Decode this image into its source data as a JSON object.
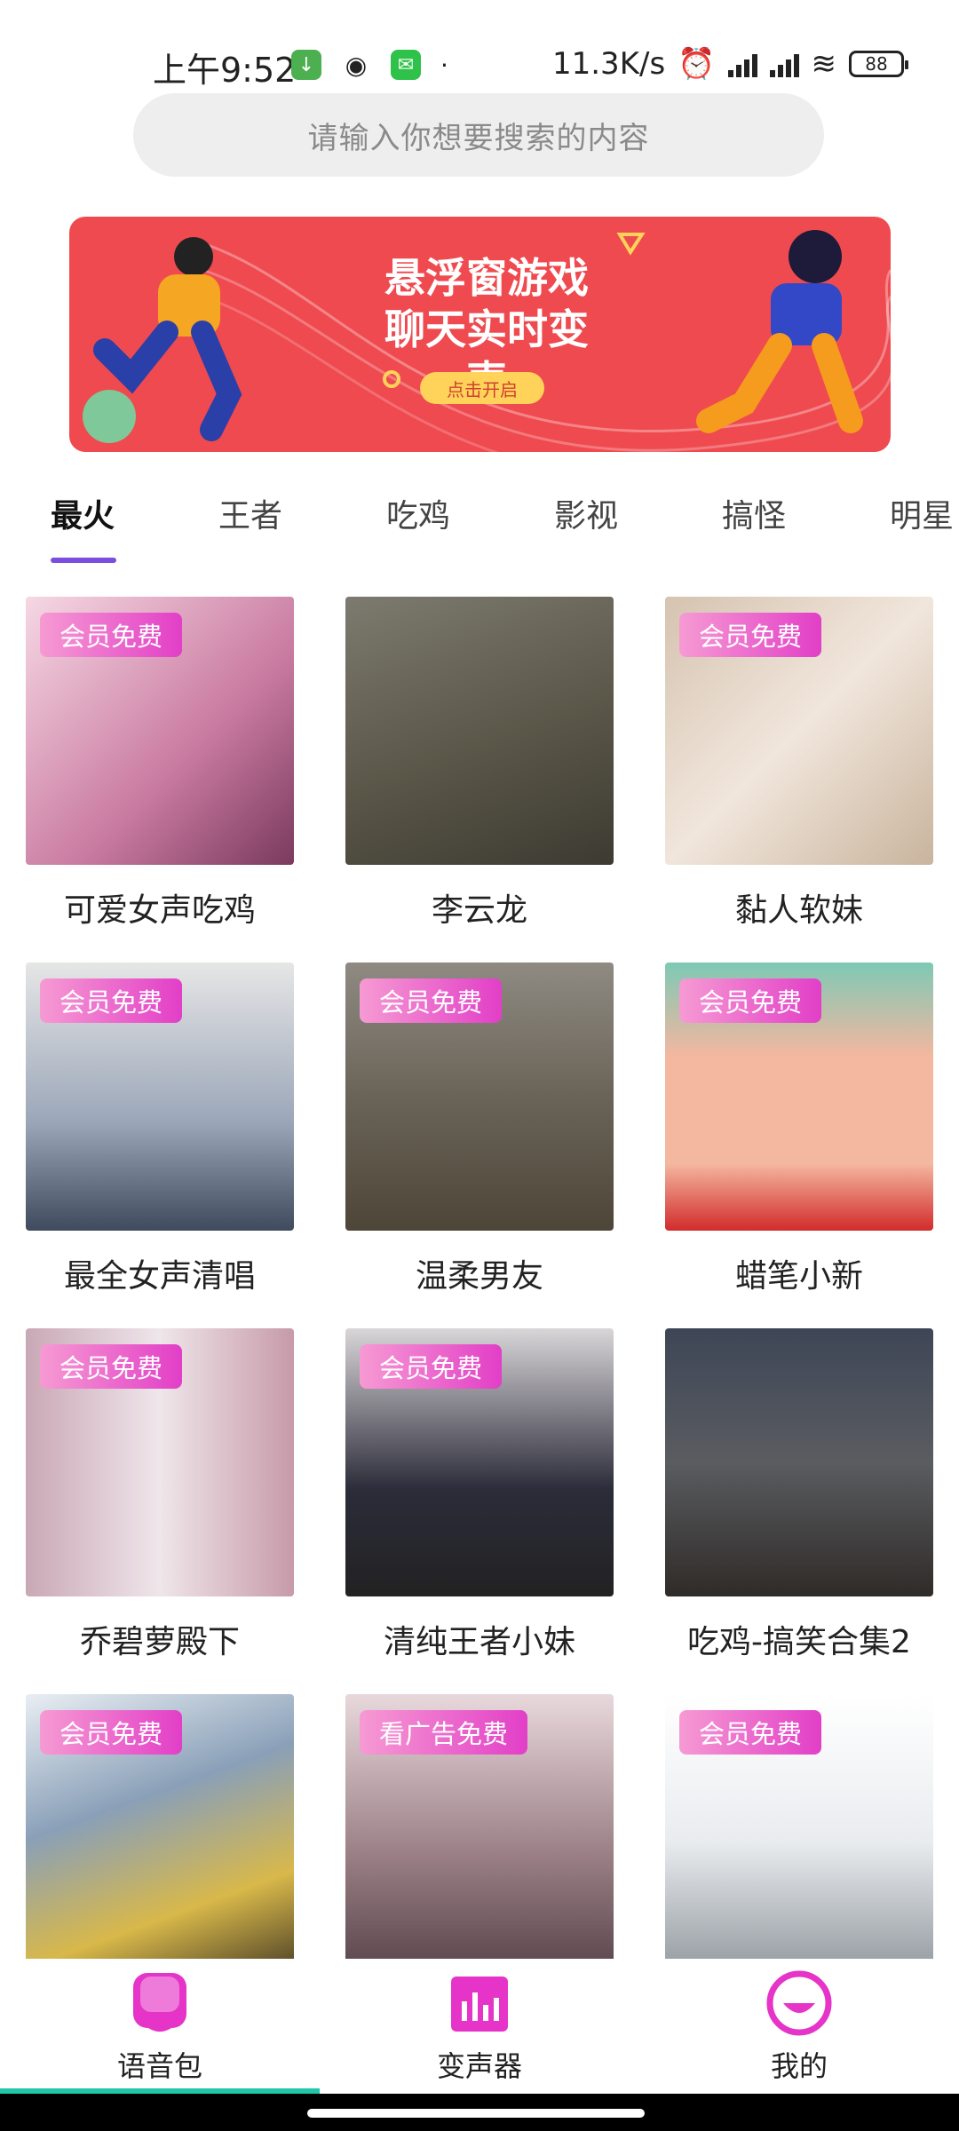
{
  "status_bar": {
    "time": "上午9:52",
    "net_speed": "11.3K/s",
    "battery": "88"
  },
  "search": {
    "placeholder": "请输入你想要搜索的内容"
  },
  "banner": {
    "title_line1": "悬浮窗游戏",
    "title_line2": "聊天实时变声",
    "button": "点击开启"
  },
  "tabs": [
    {
      "label": "最火",
      "active": true
    },
    {
      "label": "王者"
    },
    {
      "label": "吃鸡"
    },
    {
      "label": "影视"
    },
    {
      "label": "搞怪"
    },
    {
      "label": "明星"
    }
  ],
  "cards": [
    {
      "title": "可爱女声吃鸡",
      "badge": "会员免费"
    },
    {
      "title": "李云龙",
      "badge": ""
    },
    {
      "title": "黏人软妹",
      "badge": "会员免费"
    },
    {
      "title": "最全女声清唱",
      "badge": "会员免费"
    },
    {
      "title": "温柔男友",
      "badge": "会员免费"
    },
    {
      "title": "蜡笔小新",
      "badge": "会员免费"
    },
    {
      "title": "乔碧萝殿下",
      "badge": "会员免费"
    },
    {
      "title": "清纯王者小妹",
      "badge": "会员免费"
    },
    {
      "title": "吃鸡-搞笑合集2",
      "badge": ""
    },
    {
      "title": "",
      "badge": "会员免费"
    },
    {
      "title": "",
      "badge": "看广告免费"
    },
    {
      "title": "",
      "badge": "会员免费"
    }
  ],
  "bottom_nav": [
    {
      "label": "语音包",
      "icon": "voice-pack-icon"
    },
    {
      "label": "变声器",
      "icon": "voice-changer-icon"
    },
    {
      "label": "我的",
      "icon": "profile-icon"
    }
  ],
  "colors": {
    "accent": "#7a4fe0",
    "badge_start": "#f69ad3",
    "badge_end": "#e23fc7",
    "nav_icon": "#e534c7",
    "banner_bg": "#ef4a4f",
    "nav_indicator": "#20c7a8"
  }
}
